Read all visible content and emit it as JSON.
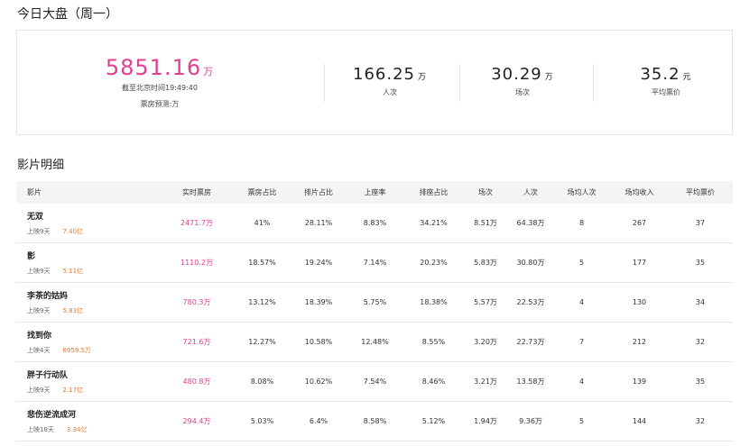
{
  "page_title": "今日大盘（周一）",
  "summary": {
    "box_office_value": "5851.16",
    "box_office_unit": "万",
    "time_text": "截至北京时间19:49:40",
    "forecast_text": "票房预测:万",
    "stats": [
      {
        "value": "166.25",
        "unit": "万",
        "label": "人次"
      },
      {
        "value": "30.29",
        "unit": "万",
        "label": "场次"
      },
      {
        "value": "35.2",
        "unit": "元",
        "label": "平均票价"
      }
    ]
  },
  "section_title": "影片明细",
  "columns": [
    "影片",
    "实时票房",
    "票房占比",
    "排片占比",
    "上座率",
    "排座占比",
    "场次",
    "人次",
    "场均人次",
    "场均收入",
    "平均票价"
  ],
  "films": [
    {
      "name": "无双",
      "release": "上映9天",
      "total": "7.40亿",
      "cells": [
        "2471.7万",
        "41%",
        "28.11%",
        "8.83%",
        "34.21%",
        "8.51万",
        "64.38万",
        "8",
        "267",
        "37"
      ]
    },
    {
      "name": "影",
      "release": "上映9天",
      "total": "5.11亿",
      "cells": [
        "1110.2万",
        "18.57%",
        "19.24%",
        "7.14%",
        "20.23%",
        "5.83万",
        "30.80万",
        "5",
        "177",
        "35"
      ]
    },
    {
      "name": "李茶的姑妈",
      "release": "上映9天",
      "total": "5.83亿",
      "cells": [
        "780.3万",
        "13.12%",
        "18.39%",
        "5.75%",
        "18.38%",
        "5.57万",
        "22.53万",
        "4",
        "130",
        "34"
      ]
    },
    {
      "name": "找到你",
      "release": "上映4天",
      "total": "6959.5万",
      "cells": [
        "721.6万",
        "12.27%",
        "10.58%",
        "12.48%",
        "8.55%",
        "3.20万",
        "22.73万",
        "7",
        "212",
        "32"
      ]
    },
    {
      "name": "胖子行动队",
      "release": "上映9天",
      "total": "2.17亿",
      "cells": [
        "480.8万",
        "8.08%",
        "10.62%",
        "7.54%",
        "8.46%",
        "3.21万",
        "13.58万",
        "4",
        "139",
        "35"
      ]
    },
    {
      "name": "悲伤逆流成河",
      "release": "上映18天",
      "total": "3.34亿",
      "cells": [
        "294.4万",
        "5.03%",
        "6.4%",
        "8.58%",
        "5.12%",
        "1.94万",
        "9.36万",
        "5",
        "144",
        "32"
      ]
    }
  ]
}
